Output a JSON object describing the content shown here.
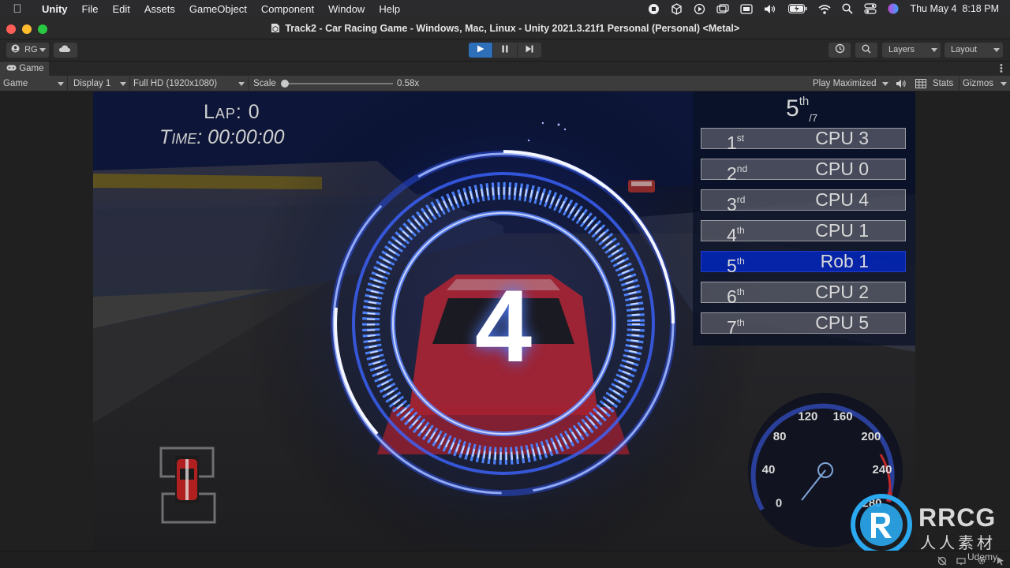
{
  "menubar": {
    "app": "Unity",
    "items": [
      "File",
      "Edit",
      "Assets",
      "GameObject",
      "Component",
      "Window",
      "Help"
    ],
    "clock": "Thu May 4  8:18 PM"
  },
  "window": {
    "title": "Track2 - Car Racing Game - Windows, Mac, Linux - Unity 2021.3.21f1 Personal (Personal) <Metal>"
  },
  "toolbar": {
    "account": "RG",
    "layers": "Layers",
    "layout": "Layout"
  },
  "tab": {
    "label": "Game"
  },
  "gamebar": {
    "view": "Game",
    "display": "Display 1",
    "resolution": "Full HD (1920x1080)",
    "scale_label": "Scale",
    "scale_value": "0.58x",
    "play_mode": "Play Maximized",
    "stats": "Stats",
    "gizmos": "Gizmos"
  },
  "hud": {
    "lap": "Lap: 0",
    "time": "Time: 00:00:00",
    "countdown": "4",
    "position": "5",
    "position_suffix": "th",
    "total": "/7",
    "leaderboard": [
      {
        "rank": "1",
        "suffix": "st",
        "name": "CPU 3",
        "me": false
      },
      {
        "rank": "2",
        "suffix": "nd",
        "name": "CPU 0",
        "me": false
      },
      {
        "rank": "3",
        "suffix": "rd",
        "name": "CPU 4",
        "me": false
      },
      {
        "rank": "4",
        "suffix": "th",
        "name": "CPU 1",
        "me": false
      },
      {
        "rank": "5",
        "suffix": "th",
        "name": "Rob 1",
        "me": true
      },
      {
        "rank": "6",
        "suffix": "th",
        "name": "CPU 2",
        "me": false
      },
      {
        "rank": "7",
        "suffix": "th",
        "name": "CPU 5",
        "me": false
      }
    ],
    "speedometer": {
      "ticks": [
        "0",
        "40",
        "80",
        "120",
        "160",
        "200",
        "240",
        "280"
      ],
      "needle_value": 0
    }
  },
  "watermark": {
    "brand": "RRCG",
    "sub": "人人素材",
    "udemy": "Udemy"
  },
  "colors": {
    "leader_highlight": "#0a2fd8",
    "accent_ring": "#4f86ff"
  }
}
